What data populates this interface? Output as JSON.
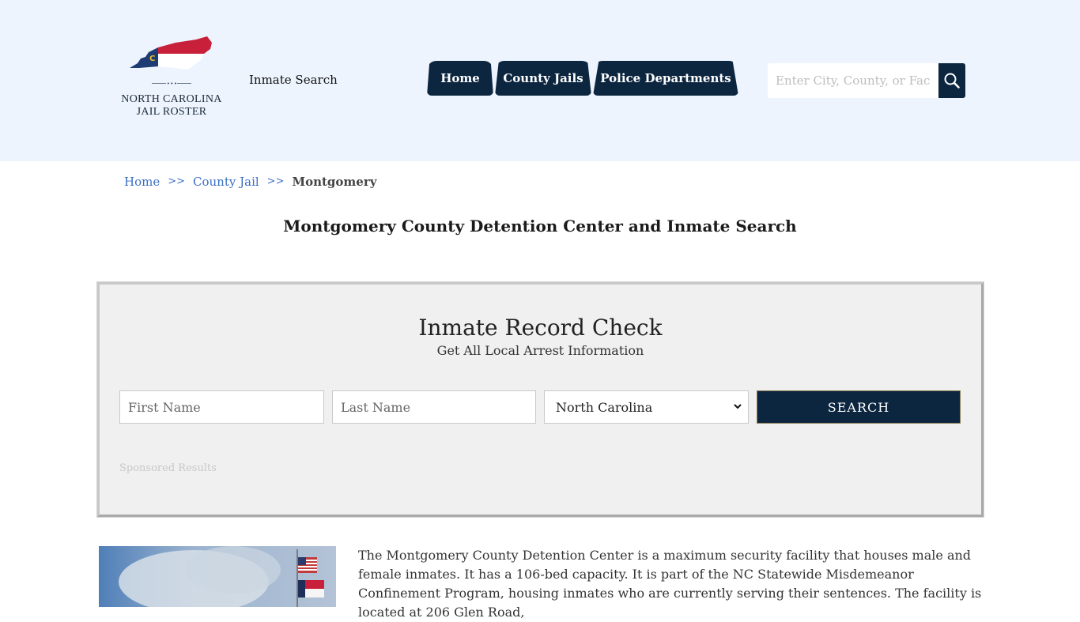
{
  "header": {
    "logo": {
      "line1": "NORTH CAROLINA",
      "line2": "JAIL ROSTER",
      "icon": "north-carolina-flag-map-icon"
    },
    "inmate_search_link": "Inmate Search",
    "nav": [
      {
        "label": "Home"
      },
      {
        "label": "County Jails"
      },
      {
        "label": "Police Departments"
      }
    ],
    "search": {
      "placeholder": "Enter City, County, or Facility",
      "button_icon": "search-icon"
    }
  },
  "breadcrumb": {
    "items": [
      {
        "label": "Home"
      },
      {
        "label": "County Jail"
      }
    ],
    "separator": ">>",
    "current": "Montgomery"
  },
  "page_title": "Montgomery County Detention Center and Inmate Search",
  "record_check": {
    "title": "Inmate Record Check",
    "subtitle": "Get All Local Arrest Information",
    "first_name_placeholder": "First Name",
    "last_name_placeholder": "Last Name",
    "state_selected": "North Carolina",
    "search_label": "SEARCH",
    "sponsored": "Sponsored Results"
  },
  "content": {
    "photo_alt": "Flags on flagpole against cloudy sky",
    "text": "The Montgomery County Detention Center is a maximum security facility that houses male and female inmates. It has a 106-bed capacity. It is part of the NC Statewide Misdemeanor Confinement Program, housing inmates who are currently serving their sentences. The facility is located at 206 Glen Road,"
  },
  "colors": {
    "header_bg": "#edf4fd",
    "navy": "#0c2640",
    "link_blue": "#3a6fc4",
    "panel_bg": "#f0f0f0"
  }
}
